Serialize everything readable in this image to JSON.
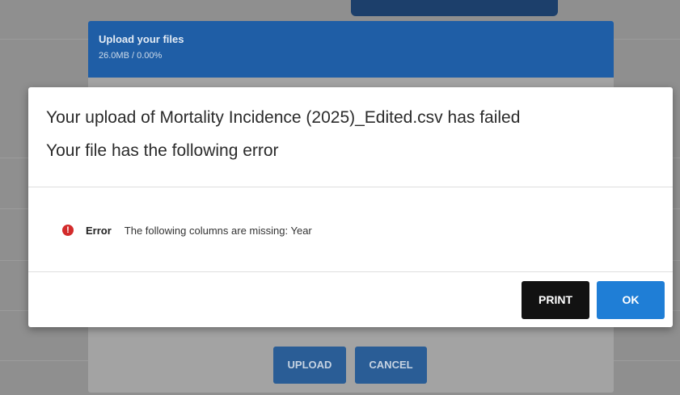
{
  "background_dialog": {
    "title": "Upload your files",
    "progress": "26.0MB / 0.00%",
    "upload_button": "UPLOAD",
    "cancel_button": "CANCEL"
  },
  "error_modal": {
    "title_line1": "Your upload of Mortality Incidence (2025)_Edited.csv has failed",
    "title_line2": "Your file has the following error",
    "error": {
      "icon": "exclamation-icon",
      "label": "Error",
      "message": "The following columns are missing: Year"
    },
    "print_button": "PRINT",
    "ok_button": "OK"
  },
  "colors": {
    "header_blue": "#1f5ea6",
    "ok_blue": "#1f7ed6",
    "error_red": "#d32b2b",
    "print_black": "#121212"
  }
}
